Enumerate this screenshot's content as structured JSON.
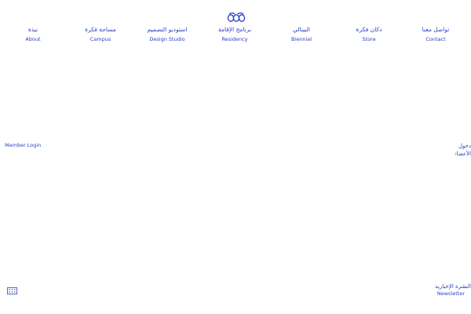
{
  "brand": {
    "logo_icon": "fikra-logo-icon",
    "accent_color": "#2a3fc4"
  },
  "nav": {
    "items": [
      {
        "ar": "نبذة",
        "en": "About"
      },
      {
        "ar": "مساحة فكرة",
        "en": "Campus"
      },
      {
        "ar": "استوديو التصميم",
        "en": "Design Studio"
      },
      {
        "ar": "برنامج الإقامة",
        "en": "Residency"
      },
      {
        "ar": "البينالي",
        "en": "Biennial"
      },
      {
        "ar": "دكان فكرة",
        "en": "Store"
      },
      {
        "ar": "تواصل معنا",
        "en": "Contact"
      }
    ]
  },
  "member_login": {
    "en": "Member Login",
    "ar_line1": "دخول",
    "ar_line2": "الأعضاء"
  },
  "footer": {
    "menu_icon": "grid-menu-icon",
    "newsletter_ar": "النشرة الإخبارية",
    "newsletter_en": "Newsletter"
  }
}
